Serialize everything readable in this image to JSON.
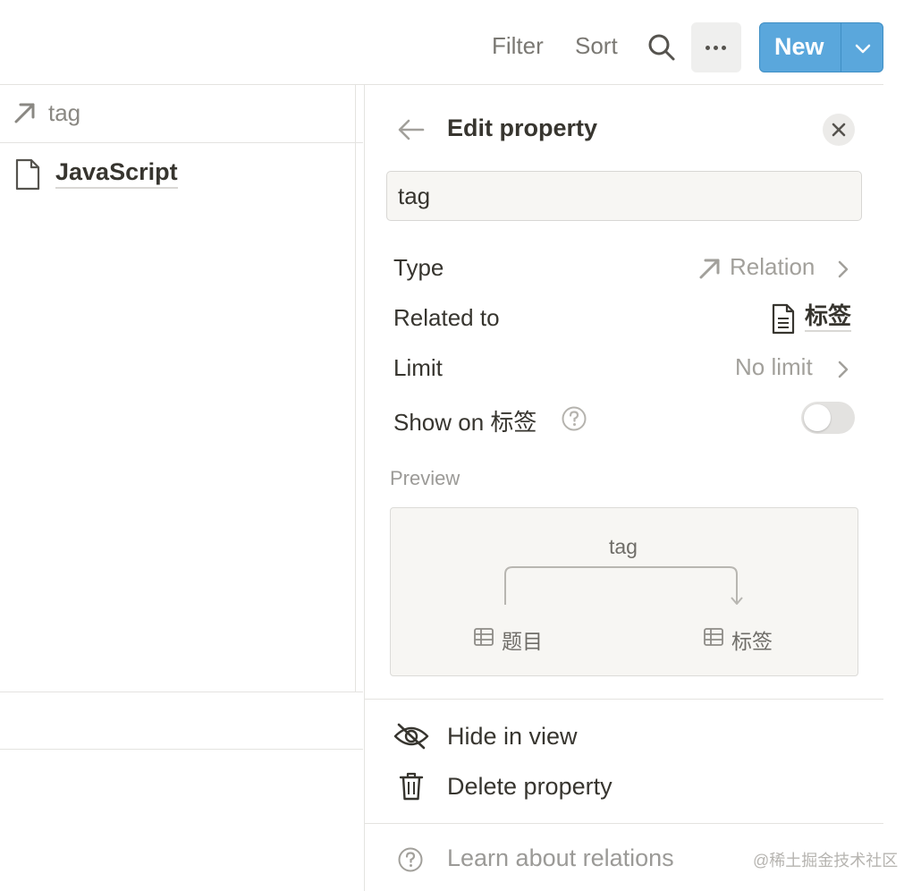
{
  "toolbar": {
    "filter_label": "Filter",
    "sort_label": "Sort",
    "search_icon": "search-icon",
    "more_icon": "more-horizontal-icon",
    "new_label": "New",
    "new_dropdown_icon": "chevron-down-icon",
    "accent_color": "#5aa7dc"
  },
  "table": {
    "column_header": {
      "icon": "relation-arrow-icon",
      "label": "tag"
    },
    "rows": [
      {
        "icon": "page-icon",
        "title": "JavaScript"
      }
    ]
  },
  "panel": {
    "back_icon": "arrow-left-icon",
    "title": "Edit property",
    "close_icon": "close-icon",
    "name_value": "tag",
    "type": {
      "label": "Type",
      "icon": "relation-arrow-icon",
      "value": "Relation"
    },
    "related_to": {
      "label": "Related to",
      "icon": "page-icon",
      "value": "标签"
    },
    "limit": {
      "label": "Limit",
      "value": "No limit"
    },
    "show_on": {
      "label": "Show on 标签",
      "help_icon": "question-circle-icon",
      "enabled": false
    },
    "preview": {
      "label": "Preview",
      "relation_name": "tag",
      "source": {
        "icon": "table-icon",
        "label": "题目"
      },
      "target": {
        "icon": "table-icon",
        "label": "标签"
      }
    },
    "actions": [
      {
        "icon": "eye-slash-icon",
        "label": "Hide in view"
      },
      {
        "icon": "trash-icon",
        "label": "Delete property"
      }
    ],
    "learn": {
      "icon": "question-circle-icon",
      "label": "Learn about relations"
    }
  },
  "watermark": "@稀土掘金技术社区"
}
